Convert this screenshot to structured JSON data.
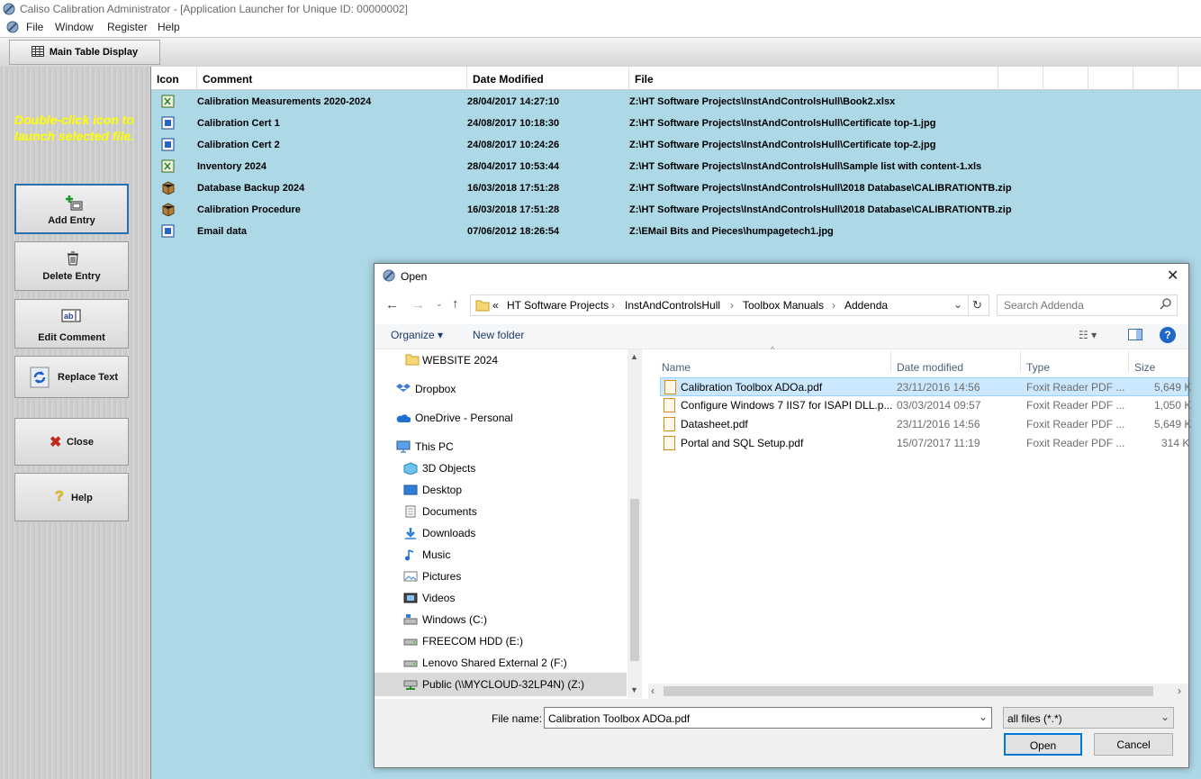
{
  "window": {
    "title": "Caliso Calibration Administrator - [Application Launcher for Unique ID: 00000002]"
  },
  "menu": [
    "File",
    "Window",
    "Register",
    "Help"
  ],
  "toolbar": {
    "main_table_display": "Main Table Display"
  },
  "sidebar": {
    "hint": "Double-click icon to launch selected file.",
    "buttons": {
      "add": "Add Entry",
      "delete": "Delete Entry",
      "edit": "Edit Comment",
      "replace": "Replace Text",
      "close": "Close",
      "help": "Help"
    }
  },
  "grid": {
    "headers": [
      "Icon",
      "Comment",
      "Date Modified",
      "File"
    ],
    "rows": [
      {
        "comment": "Calibration Measurements 2020-2024",
        "date": "28/04/2017 14:27:10",
        "file": "Z:\\HT Software Projects\\InstAndControlsHull\\Book2.xlsx",
        "icon": "excel-icon"
      },
      {
        "comment": "Calibration Cert 1",
        "date": "24/08/2017 10:18:30",
        "file": "Z:\\HT Software Projects\\InstAndControlsHull\\Certificate top-1.jpg",
        "icon": "image-icon"
      },
      {
        "comment": "Calibration Cert 2",
        "date": "24/08/2017 10:24:26",
        "file": "Z:\\HT Software Projects\\InstAndControlsHull\\Certificate top-2.jpg",
        "icon": "image-icon"
      },
      {
        "comment": "Inventory 2024",
        "date": "28/04/2017 10:53:44",
        "file": "Z:\\HT Software Projects\\InstAndControlsHull\\Sample list with content-1.xls",
        "icon": "excel-icon"
      },
      {
        "comment": "Database Backup 2024",
        "date": "16/03/2018 17:51:28",
        "file": "Z:\\HT Software Projects\\InstAndControlsHull\\2018 Database\\CALIBRATIONTB.zip",
        "icon": "archive-icon"
      },
      {
        "comment": "Calibration Procedure",
        "date": "16/03/2018 17:51:28",
        "file": "Z:\\HT Software Projects\\InstAndControlsHull\\2018 Database\\CALIBRATIONTB.zip",
        "icon": "archive-icon"
      },
      {
        "comment": "Email data",
        "date": "07/06/2012 18:26:54",
        "file": "Z:\\EMail Bits and Pieces\\humpagetech1.jpg",
        "icon": "image-icon"
      }
    ]
  },
  "dialog": {
    "title": "Open",
    "breadcrumb": [
      "«",
      "HT Software Projects",
      "InstAndControlsHull",
      "Toolbox Manuals",
      "Addenda"
    ],
    "search_placeholder": "Search Addenda",
    "organize": "Organize ▾",
    "new_folder": "New folder",
    "nav": [
      "WEBSITE 2024",
      "Dropbox",
      "OneDrive - Personal",
      "This PC",
      "3D Objects",
      "Desktop",
      "Documents",
      "Downloads",
      "Music",
      "Pictures",
      "Videos",
      "Windows (C:)",
      "FREECOM HDD (E:)",
      "Lenovo Shared External 2 (F:)",
      "Public (\\\\MYCLOUD-32LP4N) (Z:)"
    ],
    "columns": [
      "Name",
      "Date modified",
      "Type",
      "Size"
    ],
    "files": [
      {
        "name": "Calibration Toolbox ADOa.pdf",
        "date": "23/11/2016 14:56",
        "type": "Foxit Reader PDF ...",
        "size": "5,649 K"
      },
      {
        "name": "Configure Windows 7 IIS7 for ISAPI DLL.p...",
        "date": "03/03/2014 09:57",
        "type": "Foxit Reader PDF ...",
        "size": "1,050 K"
      },
      {
        "name": "Datasheet.pdf",
        "date": "23/11/2016 14:56",
        "type": "Foxit Reader PDF ...",
        "size": "5,649 K"
      },
      {
        "name": "Portal and SQL Setup.pdf",
        "date": "15/07/2017 11:19",
        "type": "Foxit Reader PDF ...",
        "size": "314 K"
      }
    ],
    "filename_label": "File name:",
    "filename_value": "Calibration Toolbox ADOa.pdf",
    "filter": "all files (*.*)",
    "open_button": "Open",
    "cancel_button": "Cancel"
  }
}
